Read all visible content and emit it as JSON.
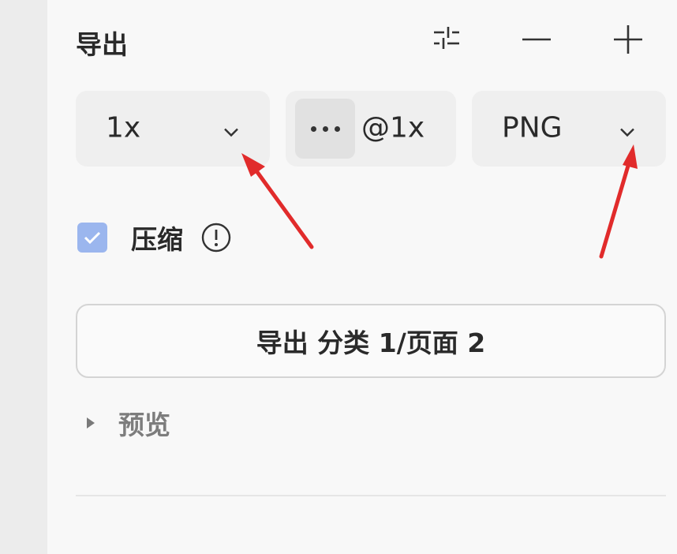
{
  "panel": {
    "title": "导出",
    "header_icons": [
      "adjust-icon",
      "minus-icon",
      "plus-icon"
    ]
  },
  "export_settings": {
    "scale_select": {
      "value": "1x",
      "icon": "chevron-down-icon"
    },
    "suffix_field": {
      "more_icon": "ellipsis-icon",
      "value": "@1x"
    },
    "format_select": {
      "value": "PNG",
      "icon": "chevron-down-icon"
    }
  },
  "compress": {
    "label": "压缩",
    "checked": true,
    "info_icon": "info-icon"
  },
  "export_button": {
    "label": "导出 分类 1/页面 2"
  },
  "preview": {
    "label": "预览",
    "icon": "caret-right-icon"
  },
  "annotations": {
    "arrows": 2,
    "color": "#e12b2b"
  },
  "colors": {
    "checkbox": "#9bb6ee",
    "panel_bg": "#f8f8f8",
    "field_bg": "#efefef",
    "arrow": "#e12b2b"
  }
}
